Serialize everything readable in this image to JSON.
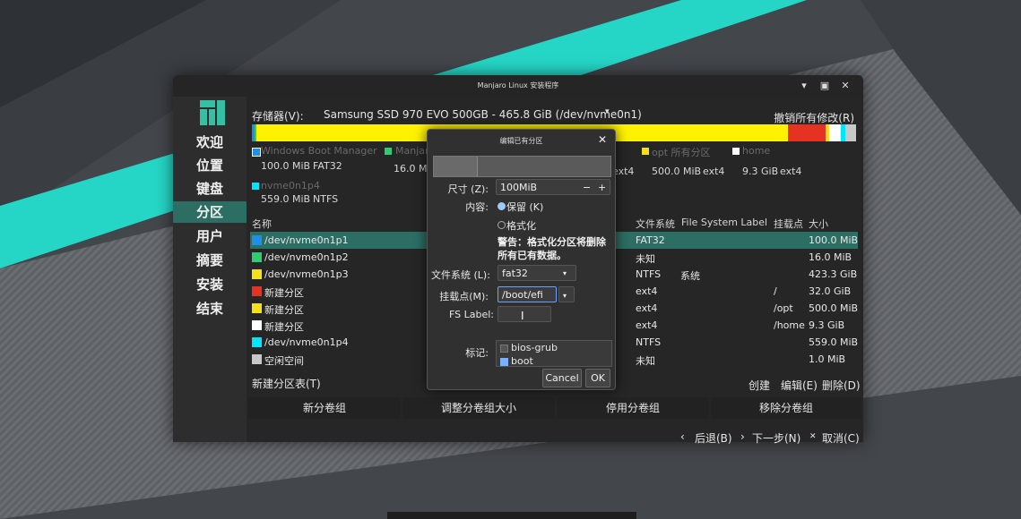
{
  "window": {
    "title": "Manjaro Linux 安装程序",
    "controls": {
      "minimize": "▾",
      "maximize": "▣",
      "close": "✕"
    }
  },
  "sidebar": {
    "items": [
      {
        "label": "欢迎"
      },
      {
        "label": "位置"
      },
      {
        "label": "键盘"
      },
      {
        "label": "分区",
        "active": true
      },
      {
        "label": "用户"
      },
      {
        "label": "摘要"
      },
      {
        "label": "安装"
      },
      {
        "label": "结束"
      }
    ]
  },
  "storage": {
    "label": "存储器(V):",
    "selected": "Samsung SSD 970 EVO 500GB - 465.8 GiB (/dev/nvme0n1)",
    "dropdown_arrow": "▾",
    "revert_all": "撤销所有修改(R)"
  },
  "legend": {
    "faded": [
      "Windows Boot Manager",
      "ManjaroLinux",
      "opt 所有分区",
      "home"
    ],
    "row1": [
      {
        "size": "100.0 MiB",
        "fs": "FAT32",
        "color": "#1f8fe5"
      },
      {
        "size": "16.0 Mi",
        "fs": "",
        "color": "#2ecc71"
      },
      {
        "size": "ext4",
        "fs": "",
        "color": ""
      },
      {
        "size": "500.0 MiB",
        "fs": "ext4",
        "color": "#f4e11c"
      },
      {
        "size": "9.3 GiB",
        "fs": "ext4",
        "color": "#ffffff"
      }
    ],
    "row2": {
      "name": "nvme0n1p4",
      "size": "559.0 MiB",
      "fs": "NTFS",
      "color": "#00e5ff"
    }
  },
  "table": {
    "headers": {
      "name": "名称",
      "fs": "文件系统",
      "fs_label": "File System Label",
      "mount": "挂载点",
      "size": "大小"
    },
    "rows": [
      {
        "name": "/dev/nvme0n1p1",
        "fs": "FAT32",
        "label": "",
        "mount": "",
        "size": "100.0 MiB",
        "color": "#1f8fe5",
        "selected": true
      },
      {
        "name": "/dev/nvme0n1p2",
        "fs": "未知",
        "label": "",
        "mount": "",
        "size": "16.0 MiB",
        "color": "#2ecc71"
      },
      {
        "name": "/dev/nvme0n1p3",
        "fs": "NTFS",
        "label": "系统",
        "mount": "",
        "size": "423.3 GiB",
        "color": "#f4e11c"
      },
      {
        "name": "新建分区",
        "fs": "ext4",
        "label": "",
        "mount": "/",
        "size": "32.0 GiB",
        "color": "#e53222"
      },
      {
        "name": "新建分区",
        "fs": "ext4",
        "label": "",
        "mount": "/opt",
        "size": "500.0 MiB",
        "color": "#f4e11c"
      },
      {
        "name": "新建分区",
        "fs": "ext4",
        "label": "",
        "mount": "/home",
        "size": "9.3 GiB",
        "color": "#ffffff"
      },
      {
        "name": "/dev/nvme0n1p4",
        "fs": "NTFS",
        "label": "",
        "mount": "",
        "size": "559.0 MiB",
        "color": "#00e5ff"
      },
      {
        "name": "空闲空间",
        "fs": "未知",
        "label": "",
        "mount": "",
        "size": "1.0 MiB",
        "color": "#c8c8c8"
      }
    ]
  },
  "actions": {
    "new_table": "新建分区表(T)",
    "create": "创建",
    "edit": "编辑(E)",
    "delete": "删除(D)",
    "new_vg": "新分卷组",
    "resize_vg": "调整分卷组大小",
    "deactivate_vg": "停用分卷组",
    "remove_vg": "移除分卷组"
  },
  "footer": {
    "back": "后退(B)",
    "next": "下一步(N)",
    "cancel": "取消(C)",
    "back_icon": "‹",
    "next_icon": "›",
    "cancel_icon": "✕"
  },
  "dialog": {
    "title": "编辑已有分区",
    "close": "✕",
    "size_label": "尺寸 (Z):",
    "size_value": "100MiB",
    "minus": "−",
    "plus": "+",
    "content_label": "内容:",
    "keep_label": "保留 (K)",
    "format_label": "格式化",
    "warning": "警告：格式化分区将删除所有已有数据。",
    "fs_label": "文件系统 (L):",
    "fs_value": "fat32",
    "mount_label": "挂载点(M):",
    "mount_value": "/boot/efi",
    "fslabel_label": "FS Label:",
    "fslabel_value": "",
    "flags_label": "标记:",
    "flags": [
      {
        "name": "bios-grub",
        "checked": false
      },
      {
        "name": "boot",
        "checked": true
      }
    ],
    "cancel": "Cancel",
    "ok": "OK"
  }
}
